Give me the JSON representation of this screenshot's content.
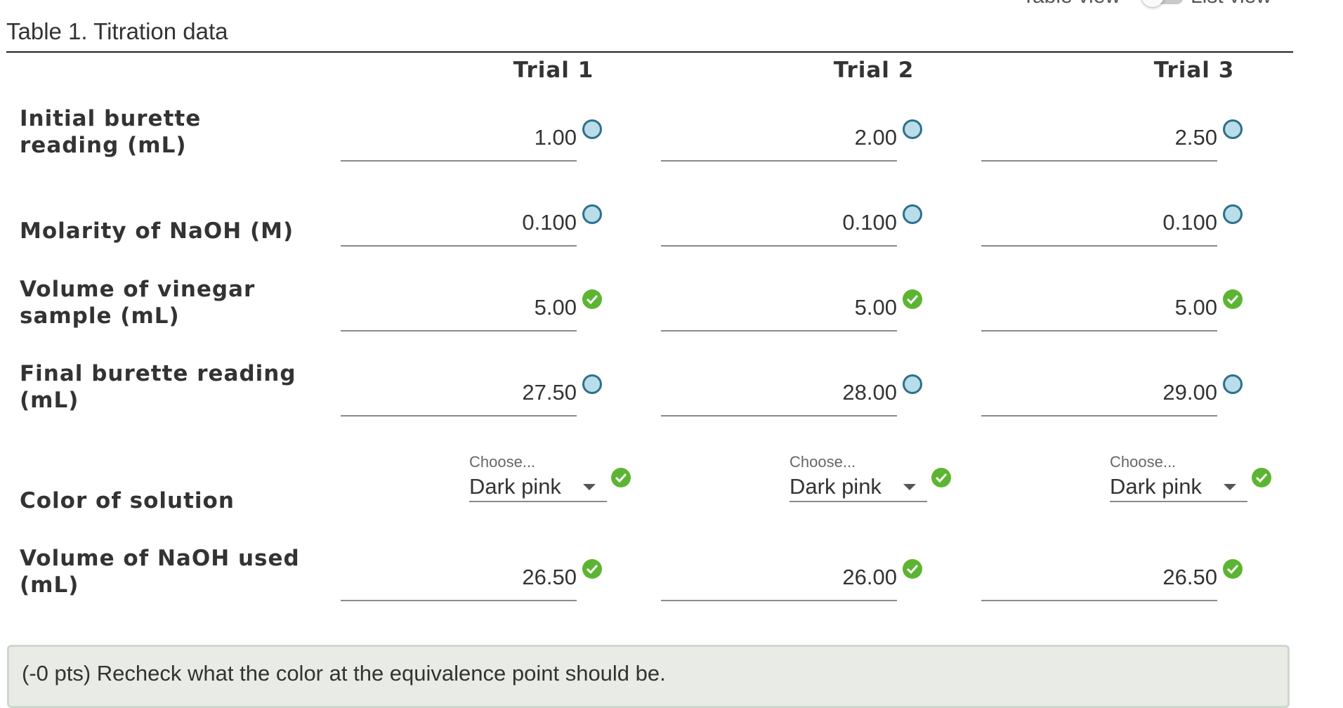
{
  "view_toggle": {
    "left_label": "Table view",
    "right_label": "List view"
  },
  "table": {
    "caption": "Table 1. Titration data",
    "columns": [
      "Trial 1",
      "Trial 2",
      "Trial 3"
    ],
    "rows": [
      {
        "label": "Initial burette reading (mL)",
        "values": [
          "1.00",
          "2.00",
          "2.50"
        ],
        "status": [
          "pending",
          "pending",
          "pending"
        ]
      },
      {
        "label": "Molarity of NaOH (M)",
        "values": [
          "0.100",
          "0.100",
          "0.100"
        ],
        "status": [
          "pending",
          "pending",
          "pending"
        ]
      },
      {
        "label": "Volume of vinegar sample (mL)",
        "values": [
          "5.00",
          "5.00",
          "5.00"
        ],
        "status": [
          "correct",
          "correct",
          "correct"
        ]
      },
      {
        "label": "Final burette reading (mL)",
        "values": [
          "27.50",
          "28.00",
          "29.00"
        ],
        "status": [
          "pending",
          "pending",
          "pending"
        ]
      },
      {
        "label": "Color of solution",
        "placeholder": "Choose...",
        "values": [
          "Dark pink",
          "Dark pink",
          "Dark pink"
        ],
        "status": [
          "correct",
          "correct",
          "correct"
        ]
      },
      {
        "label": "Volume of NaOH used (mL)",
        "values": [
          "26.50",
          "26.00",
          "26.50"
        ],
        "status": [
          "correct",
          "correct",
          "correct"
        ]
      }
    ]
  },
  "feedback": {
    "text": "(-0 pts) Recheck what the color at the equivalence point should be."
  },
  "colors": {
    "correct": "#5cb532",
    "pending_fill": "#b9dde9",
    "pending_border": "#2f6f8c"
  },
  "icons": {
    "correct": "check-circle-icon",
    "pending": "open-circle-icon",
    "dropdown": "caret-down-icon"
  }
}
